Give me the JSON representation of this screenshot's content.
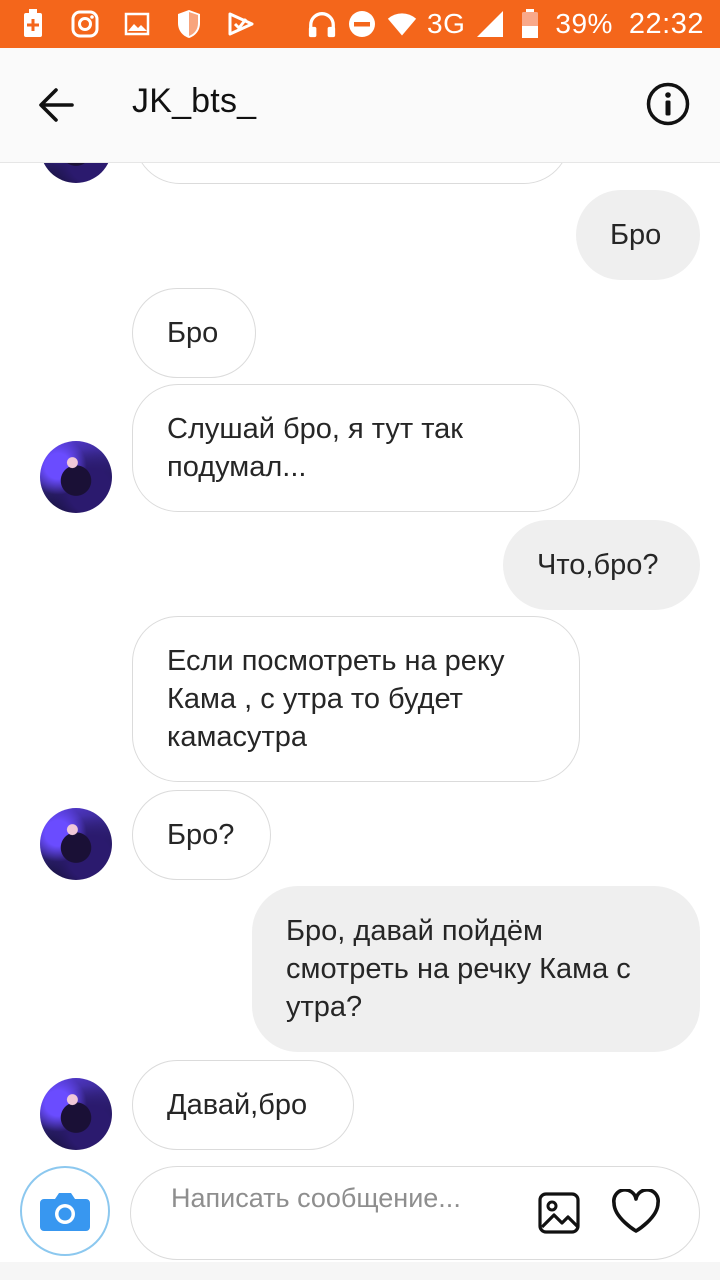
{
  "status_bar": {
    "network": "3G",
    "battery": "39%",
    "time": "22:32",
    "icons_left": [
      "battery-saver-icon",
      "instagram-icon",
      "gallery-icon",
      "shield-icon",
      "check-icon"
    ],
    "icons_right": [
      "headphones-icon",
      "do-not-disturb-icon",
      "wifi-icon",
      "signal-icon",
      "battery-icon"
    ]
  },
  "header": {
    "title": "JK_bts_",
    "back_icon": "arrow-left-icon",
    "info_icon": "info-icon"
  },
  "messages": [
    {
      "from": "them",
      "text": ""
    },
    {
      "from": "me",
      "text": "Бро"
    },
    {
      "from": "them",
      "text": "Бро"
    },
    {
      "from": "them",
      "text": "Слушай бро, я тут так подумал..."
    },
    {
      "from": "me",
      "text": "Что,бро?"
    },
    {
      "from": "them",
      "text": "Если посмотреть на реку Кама , с утра то будет камасутра"
    },
    {
      "from": "them",
      "text": "Бро?"
    },
    {
      "from": "me",
      "text": "Бро, давай пойдём смотреть на речку Кама с утра?"
    },
    {
      "from": "them",
      "text": "Давай,бро"
    }
  ],
  "composer": {
    "placeholder": "Написать сообщение...",
    "camera_icon": "camera-icon",
    "gallery_icon": "image-icon",
    "like_icon": "heart-icon"
  },
  "colors": {
    "status_bar": "#f4661b",
    "incoming_border": "#dbdbdb",
    "outgoing_bg": "#efefef",
    "camera_blue": "#3897f0"
  }
}
